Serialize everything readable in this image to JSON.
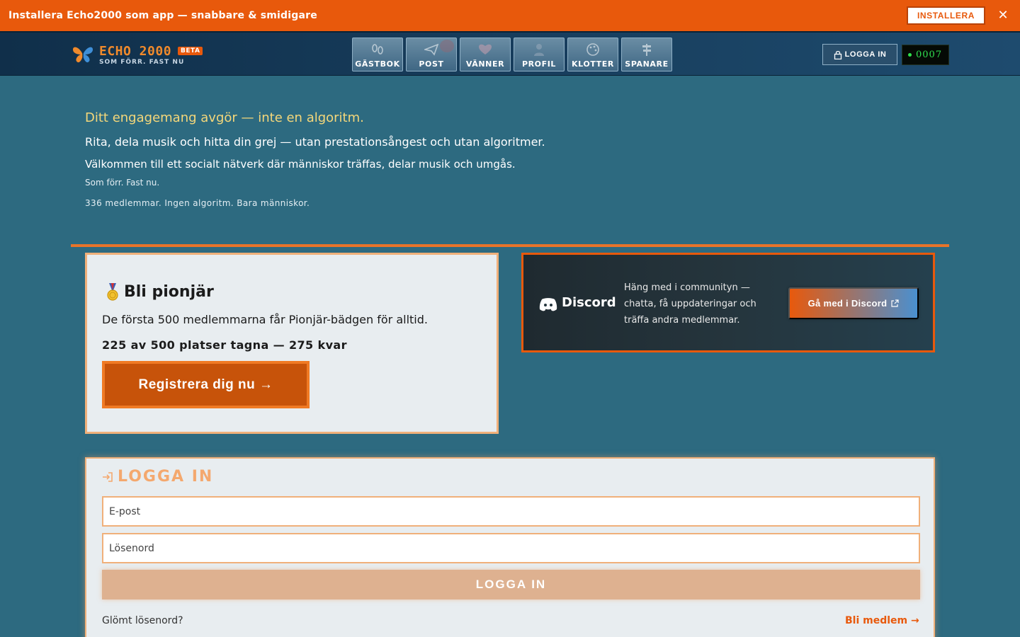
{
  "install_banner": {
    "text": "Installera Echo2000 som app — snabbare & smidigare",
    "button_label": "INSTALLERA",
    "close_icon": "close-icon"
  },
  "header": {
    "logo": {
      "title": "ECHO 2000",
      "badge": "BETA",
      "subtitle": "SOM FÖRR. FAST NU"
    },
    "nav": [
      {
        "label": "GÄSTBOK",
        "icon": "footprints-icon"
      },
      {
        "label": "POST",
        "icon": "paper-plane-icon"
      },
      {
        "label": "VÄNNER",
        "icon": "heart-icon"
      },
      {
        "label": "PROFIL",
        "icon": "person-icon"
      },
      {
        "label": "KLOTTER",
        "icon": "palette-icon"
      },
      {
        "label": "SPANARE",
        "icon": "signpost-icon"
      }
    ],
    "login_label": "LOGGA IN",
    "counter": "0007"
  },
  "hero": {
    "tagline": "Ditt engagemang avgör — inte en algoritm.",
    "line1": "Rita, dela musik och hitta din grej — utan prestationsångest och utan algoritmer.",
    "line2": "Välkommen till ett socialt nätverk där människor träffas, delar musik och umgås.",
    "line3": "Som förr. Fast nu.",
    "members": "336 medlemmar. Ingen algoritm. Bara människor."
  },
  "pioneer": {
    "title": "Bli pionjär",
    "description": "De första 500 medlemmarna får Pionjär-bädgen för alltid.",
    "count": "225 av 500 platser tagna — 275 kvar",
    "register_label": "Registrera dig nu →"
  },
  "discord": {
    "name": "Discord",
    "description": "Häng med i communityn — chatta, få uppdateringar och träffa andra medlemmar.",
    "button_label": "Gå med i Discord"
  },
  "login": {
    "heading": "LOGGA IN",
    "email_placeholder": "E-post",
    "password_placeholder": "Lösenord",
    "submit_label": "LOGGA IN",
    "forgot": "Glömt lösenord?",
    "join": "Bli medlem →"
  },
  "colors": {
    "accent": "#e8590c",
    "background": "#2d6a80",
    "header": "#173d5c",
    "card": "#e8edf0",
    "tagline": "#f4d77a"
  }
}
